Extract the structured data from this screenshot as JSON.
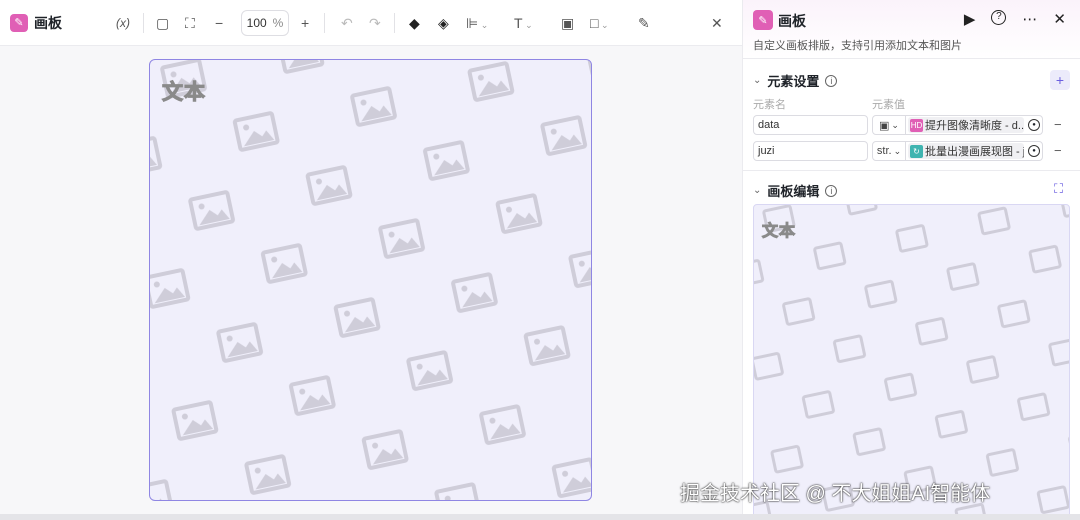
{
  "toolbar": {
    "title": "画板",
    "variable_label": "(x)",
    "zoom_value": "100",
    "zoom_unit": "%",
    "close": "✕"
  },
  "canvas": {
    "text_element": "文本"
  },
  "panel": {
    "title": "画板",
    "description": "自定义画板排版，支持引用添加文本和图片",
    "elements_section": {
      "title": "元素设置",
      "col_name": "元素名",
      "col_value": "元素值",
      "rows": [
        {
          "name": "data",
          "type": "img",
          "value": "提升图像清晰度 - d...",
          "icon_color": "#e05fb5",
          "icon_text": "HD"
        },
        {
          "name": "juzi",
          "type": "str.",
          "value": "批量出漫画展现图 - j.",
          "icon_color": "#3fb4b0",
          "icon_text": "↻"
        }
      ]
    },
    "editor_section": {
      "title": "画板编辑",
      "text_element": "文本"
    }
  },
  "watermark": "掘金技术社区 @ 不大姐姐AI智能体"
}
